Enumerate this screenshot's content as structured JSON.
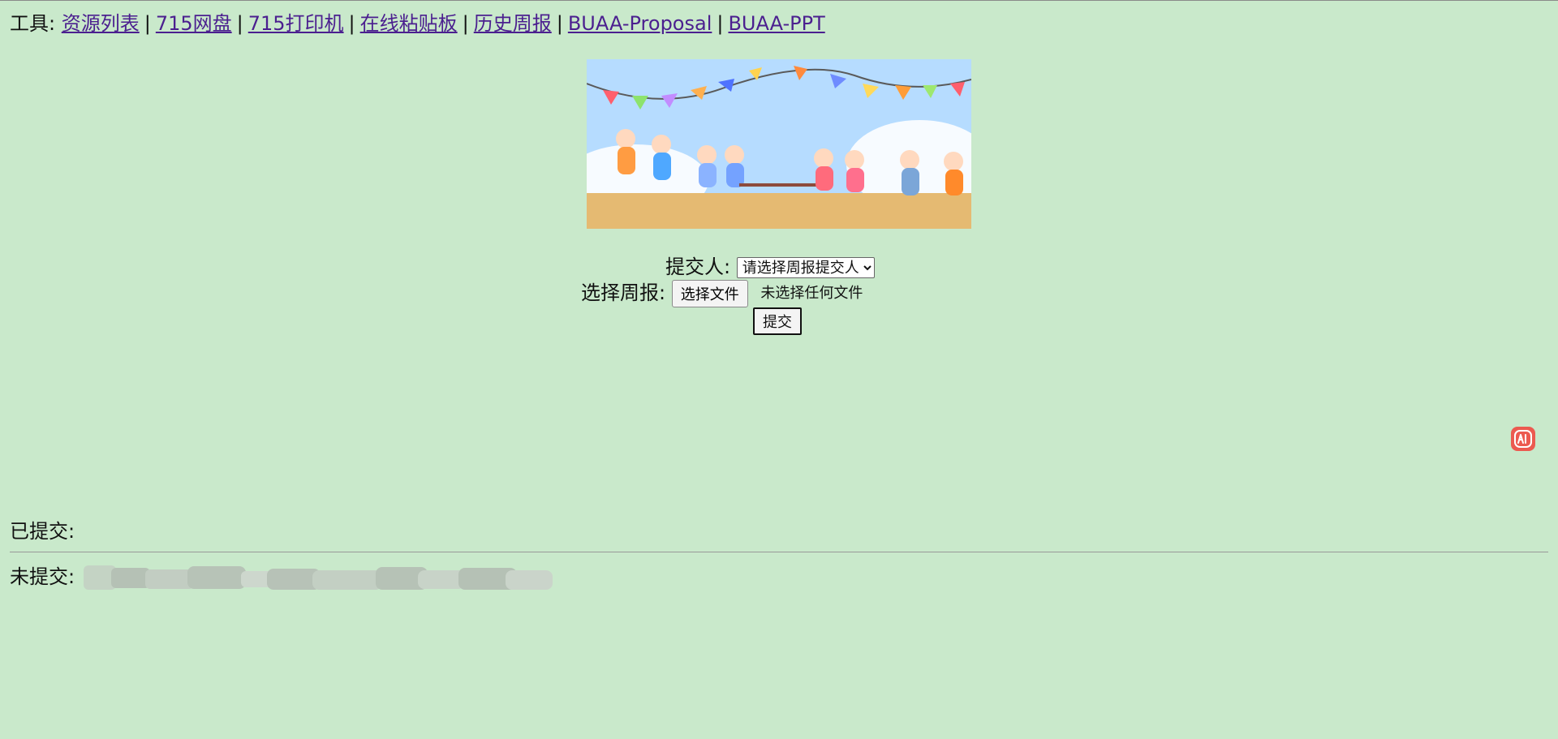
{
  "tools": {
    "label": "工具:",
    "links": [
      "资源列表",
      "715网盘",
      "715打印机",
      "在线粘贴板",
      "历史周报",
      "BUAA-Proposal",
      "BUAA-PPT"
    ]
  },
  "form": {
    "submitter_label": "提交人:",
    "submitter_select": "请选择周报提交人",
    "report_label": "选择周报:",
    "file_button": "选择文件",
    "file_status": "未选择任何文件",
    "submit_button": "提交"
  },
  "status": {
    "submitted_label": "已提交:",
    "not_submitted_label": "未提交:"
  },
  "colors": {
    "background": "#c9e9cb",
    "link": "#4b1f8f",
    "badge": "#ec5a50"
  },
  "icons": {
    "ai_badge": "ai-icon"
  }
}
